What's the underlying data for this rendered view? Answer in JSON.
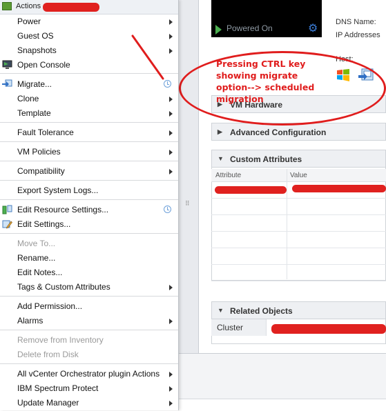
{
  "menu": {
    "header": "Actions -",
    "items": [
      {
        "label": "Power",
        "submenu": true
      },
      {
        "label": "Guest OS",
        "submenu": true
      },
      {
        "label": "Snapshots",
        "submenu": true
      },
      {
        "label": "Open Console"
      },
      {
        "label": "Migrate...",
        "clock": true
      },
      {
        "label": "Clone",
        "submenu": true
      },
      {
        "label": "Template",
        "submenu": true
      },
      {
        "label": "Fault Tolerance",
        "submenu": true
      },
      {
        "label": "VM Policies",
        "submenu": true
      },
      {
        "label": "Compatibility",
        "submenu": true
      },
      {
        "label": "Export System Logs..."
      },
      {
        "label": "Edit Resource Settings...",
        "clock": true
      },
      {
        "label": "Edit Settings..."
      },
      {
        "label": "Move To...",
        "disabled": true
      },
      {
        "label": "Rename..."
      },
      {
        "label": "Edit Notes..."
      },
      {
        "label": "Tags & Custom Attributes",
        "submenu": true
      },
      {
        "label": "Add Permission..."
      },
      {
        "label": "Alarms",
        "submenu": true
      },
      {
        "label": "Remove from Inventory",
        "disabled": true
      },
      {
        "label": "Delete from Disk",
        "disabled": true
      },
      {
        "label": "All vCenter Orchestrator plugin Actions",
        "submenu": true
      },
      {
        "label": "IBM Spectrum Protect",
        "submenu": true
      },
      {
        "label": "Update Manager",
        "submenu": true
      }
    ]
  },
  "vm": {
    "power_state": "Powered On",
    "dns_name_label": "DNS Name:",
    "ip_label": "IP Addresses",
    "host_label": "Host:"
  },
  "sections": {
    "vm_hardware": "VM Hardware",
    "advanced_config": "Advanced Configuration",
    "custom_attributes": "Custom Attributes",
    "related_objects": "Related Objects"
  },
  "custom_attributes": {
    "col_attribute": "Attribute",
    "col_value": "Value"
  },
  "related_objects": {
    "cluster_label": "Cluster"
  },
  "annotation": {
    "text": "Pressing  CTRL key showing migrate option--> scheduled migration"
  },
  "colors": {
    "annotation": "#e01d1d",
    "powered_on": "#4caf50",
    "clock_icon": "#6da0d9"
  }
}
